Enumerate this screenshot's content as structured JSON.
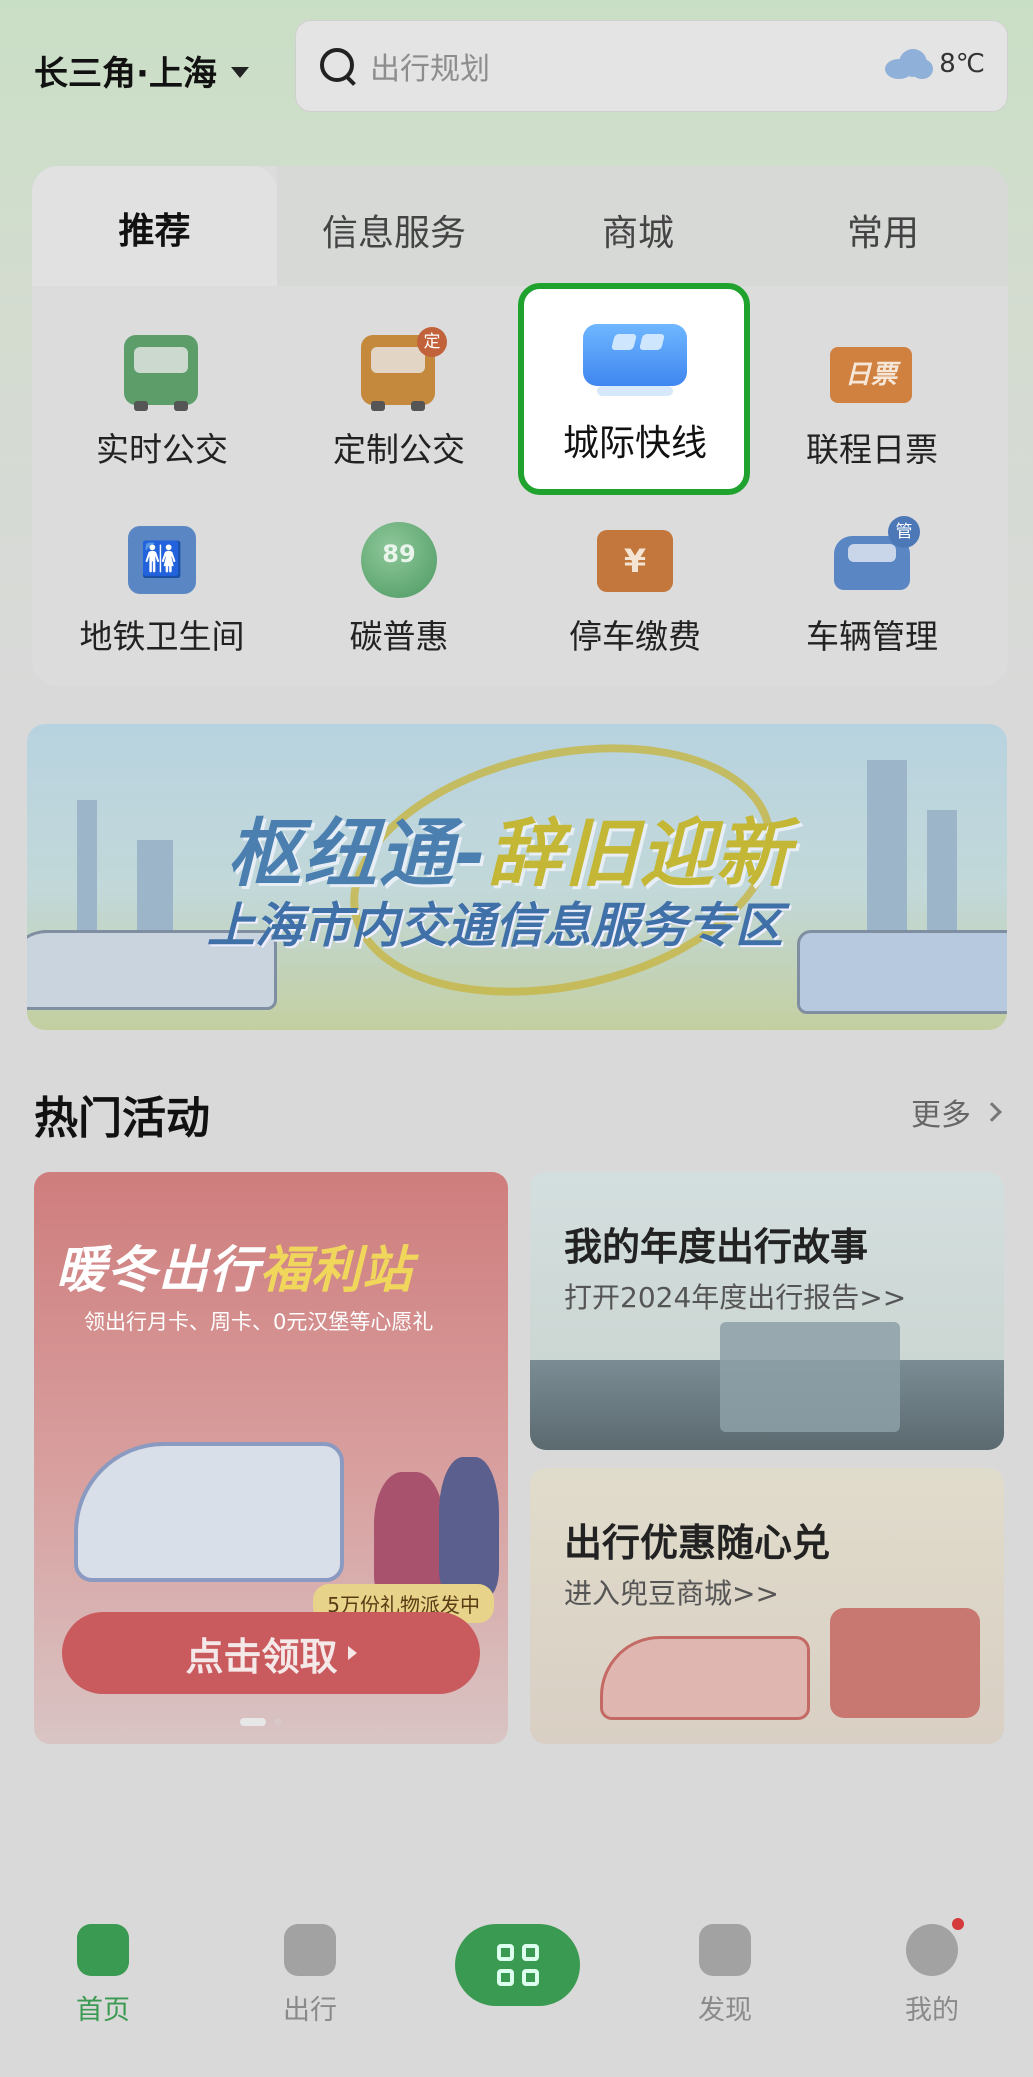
{
  "header": {
    "city": "长三角·上海",
    "search_placeholder": "出行规划",
    "weather_temp": "8℃",
    "weather_icon": "cloud-icon"
  },
  "tabs": [
    {
      "label": "推荐",
      "active": true
    },
    {
      "label": "信息服务",
      "active": false
    },
    {
      "label": "商城",
      "active": false
    },
    {
      "label": "常用",
      "active": false
    }
  ],
  "grid": [
    {
      "label": "实时公交",
      "icon": "bus-icon"
    },
    {
      "label": "定制公交",
      "icon": "custom-bus-icon",
      "badge": "定"
    },
    {
      "label": "城际快线",
      "icon": "intercity-bus-icon"
    },
    {
      "label": "联程日票",
      "icon": "day-ticket-icon",
      "badge": "日票"
    },
    {
      "label": "地铁卫生间",
      "icon": "restroom-icon"
    },
    {
      "label": "碳普惠",
      "icon": "carbon-icon",
      "badge": "89"
    },
    {
      "label": "停车缴费",
      "icon": "parking-payment-icon",
      "badge": "¥"
    },
    {
      "label": "车辆管理",
      "icon": "vehicle-management-icon",
      "badge": "管"
    }
  ],
  "banner": {
    "title_part1": "枢纽通-",
    "title_part2": "辞旧迎新",
    "subtitle": "上海市内交通信息服务专区"
  },
  "hot": {
    "title": "热门活动",
    "more": "更多"
  },
  "promo_left": {
    "title_part1": "暖冬出行",
    "title_part2": "福利站",
    "subtitle": "领出行月卡、周卡、0元汉堡等心愿礼",
    "badge": "5万份礼物派发中",
    "button": "点击领取"
  },
  "promo_right": [
    {
      "title": "我的年度出行故事",
      "subtitle": "打开2024年度出行报告>>"
    },
    {
      "title": "出行优惠随心兑",
      "subtitle": "进入兜豆商城>>"
    }
  ],
  "nav": [
    {
      "label": "首页",
      "icon": "home-icon",
      "active": true
    },
    {
      "label": "出行",
      "icon": "travel-icon",
      "active": false
    },
    {
      "label": "",
      "icon": "qr-code-icon",
      "active": false
    },
    {
      "label": "发现",
      "icon": "discover-icon",
      "active": false
    },
    {
      "label": "我的",
      "icon": "profile-icon",
      "active": false
    }
  ],
  "colors": {
    "brand_green": "#3b9a51",
    "highlight_border": "#1fa22e"
  }
}
